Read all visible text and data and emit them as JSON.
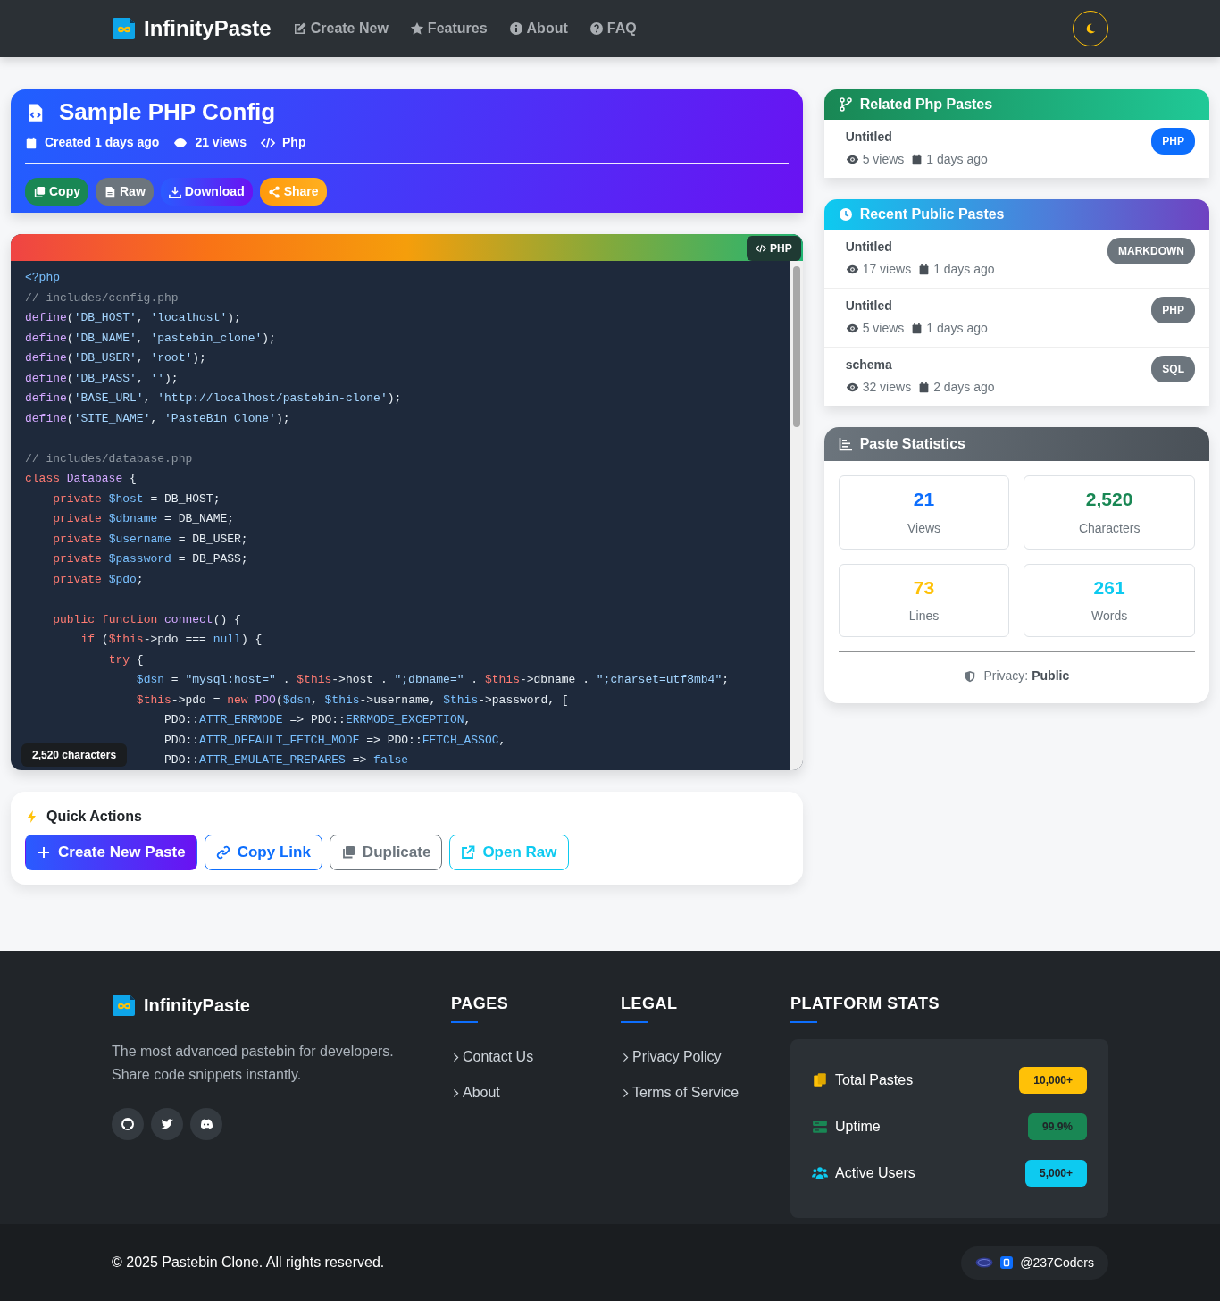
{
  "navbar": {
    "brand": "InfinityPaste",
    "links": [
      {
        "label": "Create New"
      },
      {
        "label": "Features"
      },
      {
        "label": "About"
      },
      {
        "label": "FAQ"
      }
    ]
  },
  "paste": {
    "title": "Sample PHP Config",
    "created": "Created 1 days ago",
    "views": "21 views",
    "language": "Php",
    "actions": [
      {
        "label": "Copy",
        "kind": "success"
      },
      {
        "label": "Raw",
        "kind": "secondary"
      },
      {
        "label": "Download",
        "kind": "gradient"
      },
      {
        "label": "Share",
        "kind": "warning"
      }
    ]
  },
  "code": {
    "language_badge": "PHP",
    "char_count": "2,520 characters",
    "lines": [
      {
        "kind": "code",
        "segments": [
          {
            "kind": "tag",
            "text": "<?php"
          }
        ]
      },
      {
        "kind": "code",
        "segments": [
          {
            "kind": "comment",
            "text": "// includes/config.php"
          }
        ]
      },
      {
        "kind": "code",
        "segments": [
          {
            "kind": "function",
            "text": "define"
          },
          {
            "kind": "plain",
            "text": "("
          },
          {
            "kind": "string",
            "text": "'DB_HOST'"
          },
          {
            "kind": "plain",
            "text": ", "
          },
          {
            "kind": "string",
            "text": "'localhost'"
          },
          {
            "kind": "plain",
            "text": ");"
          }
        ]
      },
      {
        "kind": "code",
        "segments": [
          {
            "kind": "function",
            "text": "define"
          },
          {
            "kind": "plain",
            "text": "("
          },
          {
            "kind": "string",
            "text": "'DB_NAME'"
          },
          {
            "kind": "plain",
            "text": ", "
          },
          {
            "kind": "string",
            "text": "'pastebin_clone'"
          },
          {
            "kind": "plain",
            "text": ");"
          }
        ]
      },
      {
        "kind": "code",
        "segments": [
          {
            "kind": "function",
            "text": "define"
          },
          {
            "kind": "plain",
            "text": "("
          },
          {
            "kind": "string",
            "text": "'DB_USER'"
          },
          {
            "kind": "plain",
            "text": ", "
          },
          {
            "kind": "string",
            "text": "'root'"
          },
          {
            "kind": "plain",
            "text": ");"
          }
        ]
      },
      {
        "kind": "code",
        "segments": [
          {
            "kind": "function",
            "text": "define"
          },
          {
            "kind": "plain",
            "text": "("
          },
          {
            "kind": "string",
            "text": "'DB_PASS'"
          },
          {
            "kind": "plain",
            "text": ", "
          },
          {
            "kind": "string",
            "text": "''"
          },
          {
            "kind": "plain",
            "text": ");"
          }
        ]
      },
      {
        "kind": "code",
        "segments": [
          {
            "kind": "function",
            "text": "define"
          },
          {
            "kind": "plain",
            "text": "("
          },
          {
            "kind": "string",
            "text": "'BASE_URL'"
          },
          {
            "kind": "plain",
            "text": ", "
          },
          {
            "kind": "string",
            "text": "'http://localhost/pastebin-clone'"
          },
          {
            "kind": "plain",
            "text": ");"
          }
        ]
      },
      {
        "kind": "code",
        "segments": [
          {
            "kind": "function",
            "text": "define"
          },
          {
            "kind": "plain",
            "text": "("
          },
          {
            "kind": "string",
            "text": "'SITE_NAME'"
          },
          {
            "kind": "plain",
            "text": ", "
          },
          {
            "kind": "string",
            "text": "'PasteBin Clone'"
          },
          {
            "kind": "plain",
            "text": ");"
          }
        ]
      },
      {
        "kind": "blank"
      },
      {
        "kind": "code",
        "segments": [
          {
            "kind": "comment",
            "text": "// includes/database.php"
          }
        ]
      },
      {
        "kind": "code",
        "segments": [
          {
            "kind": "keyword",
            "text": "class "
          },
          {
            "kind": "function",
            "text": "Database"
          },
          {
            "kind": "plain",
            "text": " {"
          }
        ]
      },
      {
        "kind": "code",
        "segments": [
          {
            "kind": "keyword",
            "text": "    private "
          },
          {
            "kind": "variable",
            "text": "$host"
          },
          {
            "kind": "plain",
            "text": " = DB_HOST;"
          }
        ]
      },
      {
        "kind": "code",
        "segments": [
          {
            "kind": "keyword",
            "text": "    private "
          },
          {
            "kind": "variable",
            "text": "$dbname"
          },
          {
            "kind": "plain",
            "text": " = DB_NAME;"
          }
        ]
      },
      {
        "kind": "code",
        "segments": [
          {
            "kind": "keyword",
            "text": "    private "
          },
          {
            "kind": "variable",
            "text": "$username"
          },
          {
            "kind": "plain",
            "text": " = DB_USER;"
          }
        ]
      },
      {
        "kind": "code",
        "segments": [
          {
            "kind": "keyword",
            "text": "    private "
          },
          {
            "kind": "variable",
            "text": "$password"
          },
          {
            "kind": "plain",
            "text": " = DB_PASS;"
          }
        ]
      },
      {
        "kind": "code",
        "segments": [
          {
            "kind": "keyword",
            "text": "    private "
          },
          {
            "kind": "variable",
            "text": "$pdo"
          },
          {
            "kind": "plain",
            "text": ";"
          }
        ]
      },
      {
        "kind": "blank"
      },
      {
        "kind": "code",
        "segments": [
          {
            "kind": "keyword",
            "text": "    public function "
          },
          {
            "kind": "function",
            "text": "connect"
          },
          {
            "kind": "plain",
            "text": "() {"
          }
        ]
      },
      {
        "kind": "code",
        "segments": [
          {
            "kind": "keyword",
            "text": "        if "
          },
          {
            "kind": "plain",
            "text": "("
          },
          {
            "kind": "keyword",
            "text": "$this"
          },
          {
            "kind": "plain",
            "text": "->pdo === "
          },
          {
            "kind": "variable",
            "text": "null"
          },
          {
            "kind": "plain",
            "text": ") {"
          }
        ]
      },
      {
        "kind": "code",
        "segments": [
          {
            "kind": "keyword",
            "text": "            try"
          },
          {
            "kind": "plain",
            "text": " {"
          }
        ]
      },
      {
        "kind": "code",
        "segments": [
          {
            "kind": "variable",
            "text": "                $dsn"
          },
          {
            "kind": "plain",
            "text": " = "
          },
          {
            "kind": "string",
            "text": "\"mysql:host=\""
          },
          {
            "kind": "plain",
            "text": " . "
          },
          {
            "kind": "keyword",
            "text": "$this"
          },
          {
            "kind": "plain",
            "text": "->host . "
          },
          {
            "kind": "string",
            "text": "\";dbname=\""
          },
          {
            "kind": "plain",
            "text": " . "
          },
          {
            "kind": "keyword",
            "text": "$this"
          },
          {
            "kind": "plain",
            "text": "->dbname . "
          },
          {
            "kind": "string",
            "text": "\";charset=utf8mb4\""
          },
          {
            "kind": "plain",
            "text": ";"
          }
        ]
      },
      {
        "kind": "code",
        "segments": [
          {
            "kind": "keyword",
            "text": "                $this"
          },
          {
            "kind": "plain",
            "text": "->pdo = "
          },
          {
            "kind": "keyword",
            "text": "new "
          },
          {
            "kind": "function",
            "text": "PDO"
          },
          {
            "kind": "plain",
            "text": "("
          },
          {
            "kind": "variable",
            "text": "$dsn"
          },
          {
            "kind": "plain",
            "text": ", "
          },
          {
            "kind": "variable",
            "text": "$this"
          },
          {
            "kind": "plain",
            "text": "->username, "
          },
          {
            "kind": "variable",
            "text": "$this"
          },
          {
            "kind": "plain",
            "text": "->password, ["
          }
        ]
      },
      {
        "kind": "code",
        "segments": [
          {
            "kind": "plain",
            "text": "                    PDO::"
          },
          {
            "kind": "variable",
            "text": "ATTR_ERRMODE"
          },
          {
            "kind": "plain",
            "text": " => PDO::"
          },
          {
            "kind": "variable",
            "text": "ERRMODE_EXCEPTION"
          },
          {
            "kind": "plain",
            "text": ","
          }
        ]
      },
      {
        "kind": "code",
        "segments": [
          {
            "kind": "plain",
            "text": "                    PDO::"
          },
          {
            "kind": "variable",
            "text": "ATTR_DEFAULT_FETCH_MODE"
          },
          {
            "kind": "plain",
            "text": " => PDO::"
          },
          {
            "kind": "variable",
            "text": "FETCH_ASSOC"
          },
          {
            "kind": "plain",
            "text": ","
          }
        ]
      },
      {
        "kind": "code",
        "segments": [
          {
            "kind": "plain",
            "text": "                    PDO::"
          },
          {
            "kind": "variable",
            "text": "ATTR_EMULATE_PREPARES"
          },
          {
            "kind": "plain",
            "text": " => "
          },
          {
            "kind": "variable",
            "text": "false"
          }
        ]
      }
    ]
  },
  "quick_actions": {
    "title": "Quick Actions",
    "buttons": [
      {
        "label": "Create New Paste",
        "kind": "gradient"
      },
      {
        "label": "Copy Link",
        "kind": "outline-primary"
      },
      {
        "label": "Duplicate",
        "kind": "outline-secondary"
      },
      {
        "label": "Open Raw",
        "kind": "outline-info"
      }
    ]
  },
  "related": {
    "title": "Related Php Pastes",
    "items": [
      {
        "title": "Untitled",
        "views": "5 views",
        "date": "1 days ago",
        "language": "PHP",
        "color": "#0d6efd"
      }
    ]
  },
  "recent": {
    "title": "Recent Public Pastes",
    "items": [
      {
        "title": "Untitled",
        "views": "17 views",
        "date": "1 days ago",
        "language": "MARKDOWN",
        "color": "#6c757d"
      },
      {
        "title": "Untitled",
        "views": "5 views",
        "date": "1 days ago",
        "language": "PHP",
        "color": "#6c757d"
      },
      {
        "title": "schema",
        "views": "32 views",
        "date": "2 days ago",
        "language": "SQL",
        "color": "#6c757d"
      }
    ]
  },
  "stats": {
    "title": "Paste Statistics",
    "tiles": [
      {
        "value": "21",
        "label": "Views",
        "color": "#0d6efd"
      },
      {
        "value": "2,520",
        "label": "Characters",
        "color": "#198754"
      },
      {
        "value": "73",
        "label": "Lines",
        "color": "#ffc107"
      },
      {
        "value": "261",
        "label": "Words",
        "color": "#0dcaf0"
      }
    ],
    "privacy_label": "Privacy:",
    "privacy_value": "Public"
  },
  "footer": {
    "brand": "InfinityPaste",
    "tagline": "The most advanced pastebin for developers. Share code snippets instantly.",
    "columns": [
      {
        "title": "PAGES",
        "links": [
          "Contact Us",
          "About"
        ]
      },
      {
        "title": "LEGAL",
        "links": [
          "Privacy Policy",
          "Terms of Service"
        ]
      }
    ],
    "platform": {
      "title": "PLATFORM STATS",
      "rows": [
        {
          "label": "Total Pastes",
          "value": "10,000+",
          "color": "#ffc107"
        },
        {
          "label": "Uptime",
          "value": "99.9%",
          "color": "#198754"
        },
        {
          "label": "Active Users",
          "value": "5,000+",
          "color": "#0dcaf0"
        }
      ]
    },
    "copyright": "© 2025 Pastebin Clone. All rights reserved.",
    "credit": "@237Coders"
  }
}
